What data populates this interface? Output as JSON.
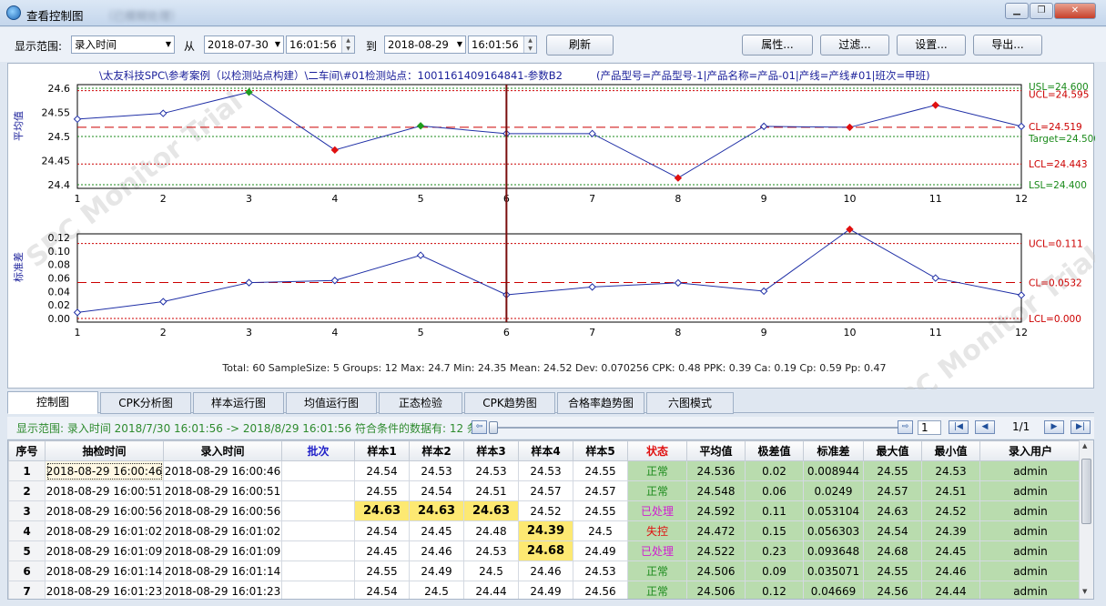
{
  "window": {
    "title": "查看控制图",
    "blurred_tag": "（已模糊处理）"
  },
  "toolbar": {
    "range_label": "显示范围:",
    "range_value": "录入时间",
    "from_label": "从",
    "from_date": "2018-07-30",
    "from_time": "16:01:56",
    "to_label": "到",
    "to_date": "2018-08-29",
    "to_time": "16:01:56",
    "refresh": "刷新",
    "props": "属性...",
    "filter": "过滤...",
    "settings": "设置...",
    "export": "导出..."
  },
  "chart": {
    "header": "\\太友科技SPC\\参考案例（以检测站点构建）\\二车间\\#01检测站点：1001161409164841-参数B2",
    "product": "(产品型号=产品型号-1|产品名称=产品-01|产线=产线#01|班次=甲班)",
    "watermark": "SPC Monitor Trial",
    "top_ylabel": "平均值",
    "bottom_ylabel": "标准差",
    "top_ticks": [
      "24.6",
      "24.55",
      "24.5",
      "24.45",
      "24.4"
    ],
    "bottom_ticks": [
      "0.12",
      "0.10",
      "0.08",
      "0.06",
      "0.04",
      "0.02",
      "0.00"
    ],
    "top_lines": {
      "usl": "USL=24.600",
      "ucl": "UCL=24.595",
      "cl": "CL=24.519",
      "target": "Target=24.500",
      "lcl": "LCL=24.443",
      "lsl": "LSL=24.400"
    },
    "bottom_lines": {
      "ucl": "UCL=0.111",
      "cl": "CL=0.0532",
      "lcl": "LCL=0.000"
    },
    "stats": "Total: 60   SampleSize: 5   Groups: 12   Max: 24.7   Min: 24.35   Mean: 24.52   Dev: 0.070256   CPK: 0.48   PPK: 0.39   Ca: 0.19   Cp: 0.59   Pp: 0.47",
    "colors": {
      "series": "#1f2fa6",
      "ooc": "#e01010",
      "ok": "#1e9c1e",
      "limit_red": "#cc0000",
      "limit_green": "#1a8a1a",
      "cursor": "#7a0e0e"
    }
  },
  "chart_data": [
    {
      "type": "line",
      "title": "",
      "ylabel": "平均值",
      "x": [
        1,
        2,
        3,
        4,
        5,
        6,
        7,
        8,
        9,
        10,
        11,
        12
      ],
      "values": [
        24.536,
        24.548,
        24.592,
        24.472,
        24.522,
        24.506,
        24.506,
        24.414,
        24.521,
        24.519,
        24.565,
        24.521
      ],
      "ylim": [
        24.4,
        24.6
      ],
      "limits": {
        "USL": 24.6,
        "UCL": 24.595,
        "CL": 24.519,
        "Target": 24.5,
        "LCL": 24.443,
        "LSL": 24.4
      },
      "point_colors": [
        "#ffffff",
        "#ffffff",
        "#1e9c1e",
        "#e01010",
        "#1e9c1e",
        "#ffffff",
        "#ffffff",
        "#e01010",
        "#ffffff",
        "#e01010",
        "#e01010",
        "#ffffff"
      ],
      "cursor_x": 6
    },
    {
      "type": "line",
      "title": "",
      "ylabel": "标准差",
      "x": [
        1,
        2,
        3,
        4,
        5,
        6,
        7,
        8,
        9,
        10,
        11,
        12
      ],
      "values": [
        0.0089,
        0.0249,
        0.0531,
        0.0563,
        0.0936,
        0.0351,
        0.0467,
        0.0527,
        0.0405,
        0.1321,
        0.0599,
        0.0346
      ],
      "ylim": [
        0,
        0.12
      ],
      "limits": {
        "UCL": 0.111,
        "CL": 0.0532,
        "LCL": 0.0
      },
      "point_colors": [
        "#ffffff",
        "#ffffff",
        "#ffffff",
        "#ffffff",
        "#ffffff",
        "#ffffff",
        "#ffffff",
        "#ffffff",
        "#ffffff",
        "#e01010",
        "#ffffff",
        "#ffffff"
      ],
      "cursor_x": 6
    }
  ],
  "tabs": [
    "控制图",
    "CPK分析图",
    "样本运行图",
    "均值运行图",
    "正态检验",
    "CPK趋势图",
    "合格率趋势图",
    "六图模式"
  ],
  "info": {
    "text": "显示范围: 录入时间  2018/7/30 16:01:56 -> 2018/8/29 16:01:56  符合条件的数据有: 12 条",
    "page_input": "1",
    "page_count": "1/1"
  },
  "table": {
    "headers": [
      "序号",
      "抽检时间",
      "录入时间",
      "批次",
      "样本1",
      "样本2",
      "样本3",
      "样本4",
      "样本5",
      "状态",
      "平均值",
      "极差值",
      "标准差",
      "最大值",
      "最小值",
      "录入用户"
    ],
    "rows": [
      {
        "cells": [
          "1",
          "2018-08-29 16:00:46",
          "2018-08-29 16:00:46",
          "",
          "24.54",
          "24.53",
          "24.53",
          "24.53",
          "24.55",
          "正常",
          "24.536",
          "0.02",
          "0.008944",
          "24.55",
          "24.53",
          "admin"
        ],
        "status": "ok",
        "hl": []
      },
      {
        "cells": [
          "2",
          "2018-08-29 16:00:51",
          "2018-08-29 16:00:51",
          "",
          "24.55",
          "24.54",
          "24.51",
          "24.57",
          "24.57",
          "正常",
          "24.548",
          "0.06",
          "0.0249",
          "24.57",
          "24.51",
          "admin"
        ],
        "status": "ok",
        "hl": []
      },
      {
        "cells": [
          "3",
          "2018-08-29 16:00:56",
          "2018-08-29 16:00:56",
          "",
          "24.63",
          "24.63",
          "24.63",
          "24.52",
          "24.55",
          "已处理",
          "24.592",
          "0.11",
          "0.053104",
          "24.63",
          "24.52",
          "admin"
        ],
        "status": "handled",
        "hl": [
          4,
          5,
          6
        ]
      },
      {
        "cells": [
          "4",
          "2018-08-29 16:01:02",
          "2018-08-29 16:01:02",
          "",
          "24.54",
          "24.45",
          "24.48",
          "24.39",
          "24.5",
          "失控",
          "24.472",
          "0.15",
          "0.056303",
          "24.54",
          "24.39",
          "admin"
        ],
        "status": "ooc",
        "hl": [
          7
        ]
      },
      {
        "cells": [
          "5",
          "2018-08-29 16:01:09",
          "2018-08-29 16:01:09",
          "",
          "24.45",
          "24.46",
          "24.53",
          "24.68",
          "24.49",
          "已处理",
          "24.522",
          "0.23",
          "0.093648",
          "24.68",
          "24.45",
          "admin"
        ],
        "status": "handled",
        "hl": [
          7
        ]
      },
      {
        "cells": [
          "6",
          "2018-08-29 16:01:14",
          "2018-08-29 16:01:14",
          "",
          "24.55",
          "24.49",
          "24.5",
          "24.46",
          "24.53",
          "正常",
          "24.506",
          "0.09",
          "0.035071",
          "24.55",
          "24.46",
          "admin"
        ],
        "status": "ok",
        "hl": []
      },
      {
        "cells": [
          "7",
          "2018-08-29 16:01:23",
          "2018-08-29 16:01:23",
          "",
          "24.54",
          "24.5",
          "24.44",
          "24.49",
          "24.56",
          "正常",
          "24.506",
          "0.12",
          "0.04669",
          "24.56",
          "24.44",
          "admin"
        ],
        "status": "ok",
        "hl": []
      }
    ],
    "status_colors": {
      "ok": "#1e8c1e",
      "handled": "#d01fd0",
      "ooc": "#e01010"
    }
  }
}
